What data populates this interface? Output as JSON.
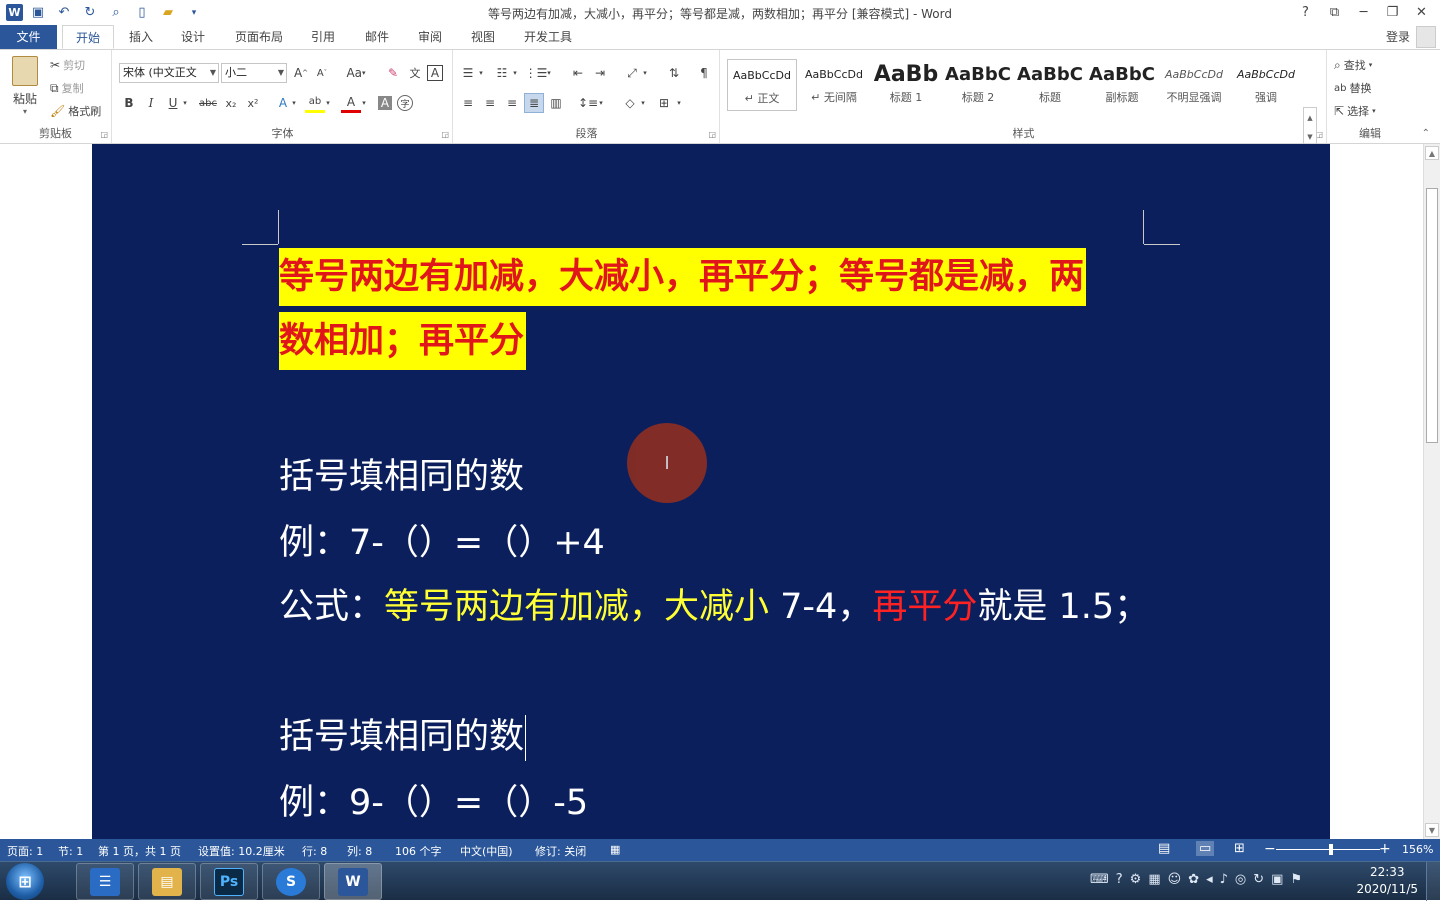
{
  "window": {
    "title": "等号两边有加减，大减小，再平分；等号都是减，两数相加；再平分 [兼容模式] - Word",
    "controls": {
      "help": "?",
      "ribbon_opts": "⧉",
      "minimize": "─",
      "restore": "❐",
      "close": "✕"
    }
  },
  "quick_access": {
    "logo": "W",
    "save_icon": "💾",
    "undo_icon": "↶",
    "redo_icon": "↻",
    "preview_icon": "🔍",
    "new_icon": "📄",
    "open_icon": "📂",
    "more_icon": "▾"
  },
  "tabs": [
    "文件",
    "开始",
    "插入",
    "设计",
    "页面布局",
    "引用",
    "邮件",
    "审阅",
    "视图",
    "开发工具"
  ],
  "account": {
    "login": "登录"
  },
  "ribbon": {
    "clipboard": {
      "paste": "粘贴",
      "cut": "剪切",
      "copy": "复制",
      "painter": "格式刷",
      "label": "剪贴板"
    },
    "font": {
      "name": "宋体 (中文正文",
      "size": "小二",
      "grow": "A˄",
      "shrink": "A˅",
      "case": "Aa",
      "clear": "✎",
      "phonetic": "文",
      "border_char": "A",
      "bold": "B",
      "italic": "I",
      "underline": "U",
      "strike": "abc",
      "sub": "x₂",
      "sup": "x²",
      "effects": "A",
      "highlight": "ab",
      "color": "A",
      "shading": "A",
      "enclose": "字",
      "label": "字体"
    },
    "paragraph": {
      "label": "段落"
    },
    "styles": {
      "label": "样式",
      "items": [
        {
          "preview": "AaBbCcDd",
          "name": "↵ 正文"
        },
        {
          "preview": "AaBbCcDd",
          "name": "↵ 无间隔"
        },
        {
          "preview": "AaBb",
          "name": "标题 1"
        },
        {
          "preview": "AaBbC",
          "name": "标题 2"
        },
        {
          "preview": "AaBbC",
          "name": "标题"
        },
        {
          "preview": "AaBbC",
          "name": "副标题"
        },
        {
          "preview": "AaBbCcDd",
          "name": "不明显强调"
        },
        {
          "preview": "AaBbCcDd",
          "name": "强调"
        }
      ]
    },
    "editing": {
      "find": "查找",
      "replace": "替换",
      "select": "选择",
      "label": "编辑"
    }
  },
  "document": {
    "heading_line1": "等号两边有加减，大减小，再平分；等号都是减，两",
    "heading_line2": "数相加；再平分",
    "block1": {
      "title": "括号填相同的数",
      "example": "例：7-（）=（）+4",
      "formula_prefix": "公式：",
      "formula_yellow": "等号两边有加减，大减小",
      "formula_mid": " 7-4，",
      "formula_red": "再平分",
      "formula_end": "就是 1.5；"
    },
    "block2": {
      "title": "括号填相同的数",
      "example": "例：9-（）=（）-5"
    },
    "cursor_glyph": "I"
  },
  "statusbar": {
    "page": "页面: 1",
    "section": "节: 1",
    "pages": "第 1 页，共 1 页",
    "position": "设置值: 10.2厘米",
    "row": "行: 8",
    "col": "列: 8",
    "words": "106 个字",
    "language": "中文(中国)",
    "track": "修订: 关闭",
    "zoom_minus": "−",
    "zoom_plus": "+",
    "zoom": "156%"
  },
  "taskbar": {
    "apps": [
      "explorer",
      "file-manager",
      "Ps",
      "sogou",
      "Word"
    ],
    "time": "22:33",
    "date": "2020/11/5"
  },
  "colors": {
    "brand": "#2b579a",
    "page_bg": "#0b1f5c",
    "highlight": "#ffff00",
    "heading_red": "#e0161b",
    "yellow_text": "#ffff33",
    "red_text": "#ff2222"
  }
}
